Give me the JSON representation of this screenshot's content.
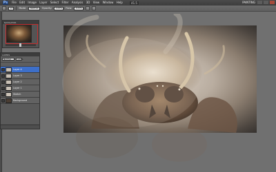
{
  "app": {
    "logo": "Ps",
    "menu": [
      "File",
      "Edit",
      "Image",
      "Layer",
      "Select",
      "Filter",
      "Analysis",
      "3D",
      "View",
      "Window",
      "Help"
    ],
    "zoom": "41.5",
    "workspace": "PAINTING"
  },
  "options_bar": {
    "brush_size": "13",
    "mode_label": "Mode:",
    "mode_value": "Normal",
    "opacity_label": "Opacity:",
    "opacity_value": "100%",
    "flow_label": "Flow:",
    "flow_value": "100%"
  },
  "navigator": {
    "tab": "NAVIGATOR",
    "zoom_percent": "38"
  },
  "layers_panel": {
    "tab": "LAYERS",
    "blend_mode": "Normal",
    "opacity": "100%",
    "layers": [
      {
        "name": "Layer 4",
        "selected": true
      },
      {
        "name": "Layer 3",
        "selected": false
      },
      {
        "name": "Layer 2",
        "selected": false
      },
      {
        "name": "Layer 1",
        "selected": false
      },
      {
        "name": "Sketch",
        "selected": false
      },
      {
        "name": "Background",
        "selected": false
      }
    ]
  },
  "colors": {
    "accent_selected": "#3d6fc9",
    "close_button": "#a64a3c"
  }
}
